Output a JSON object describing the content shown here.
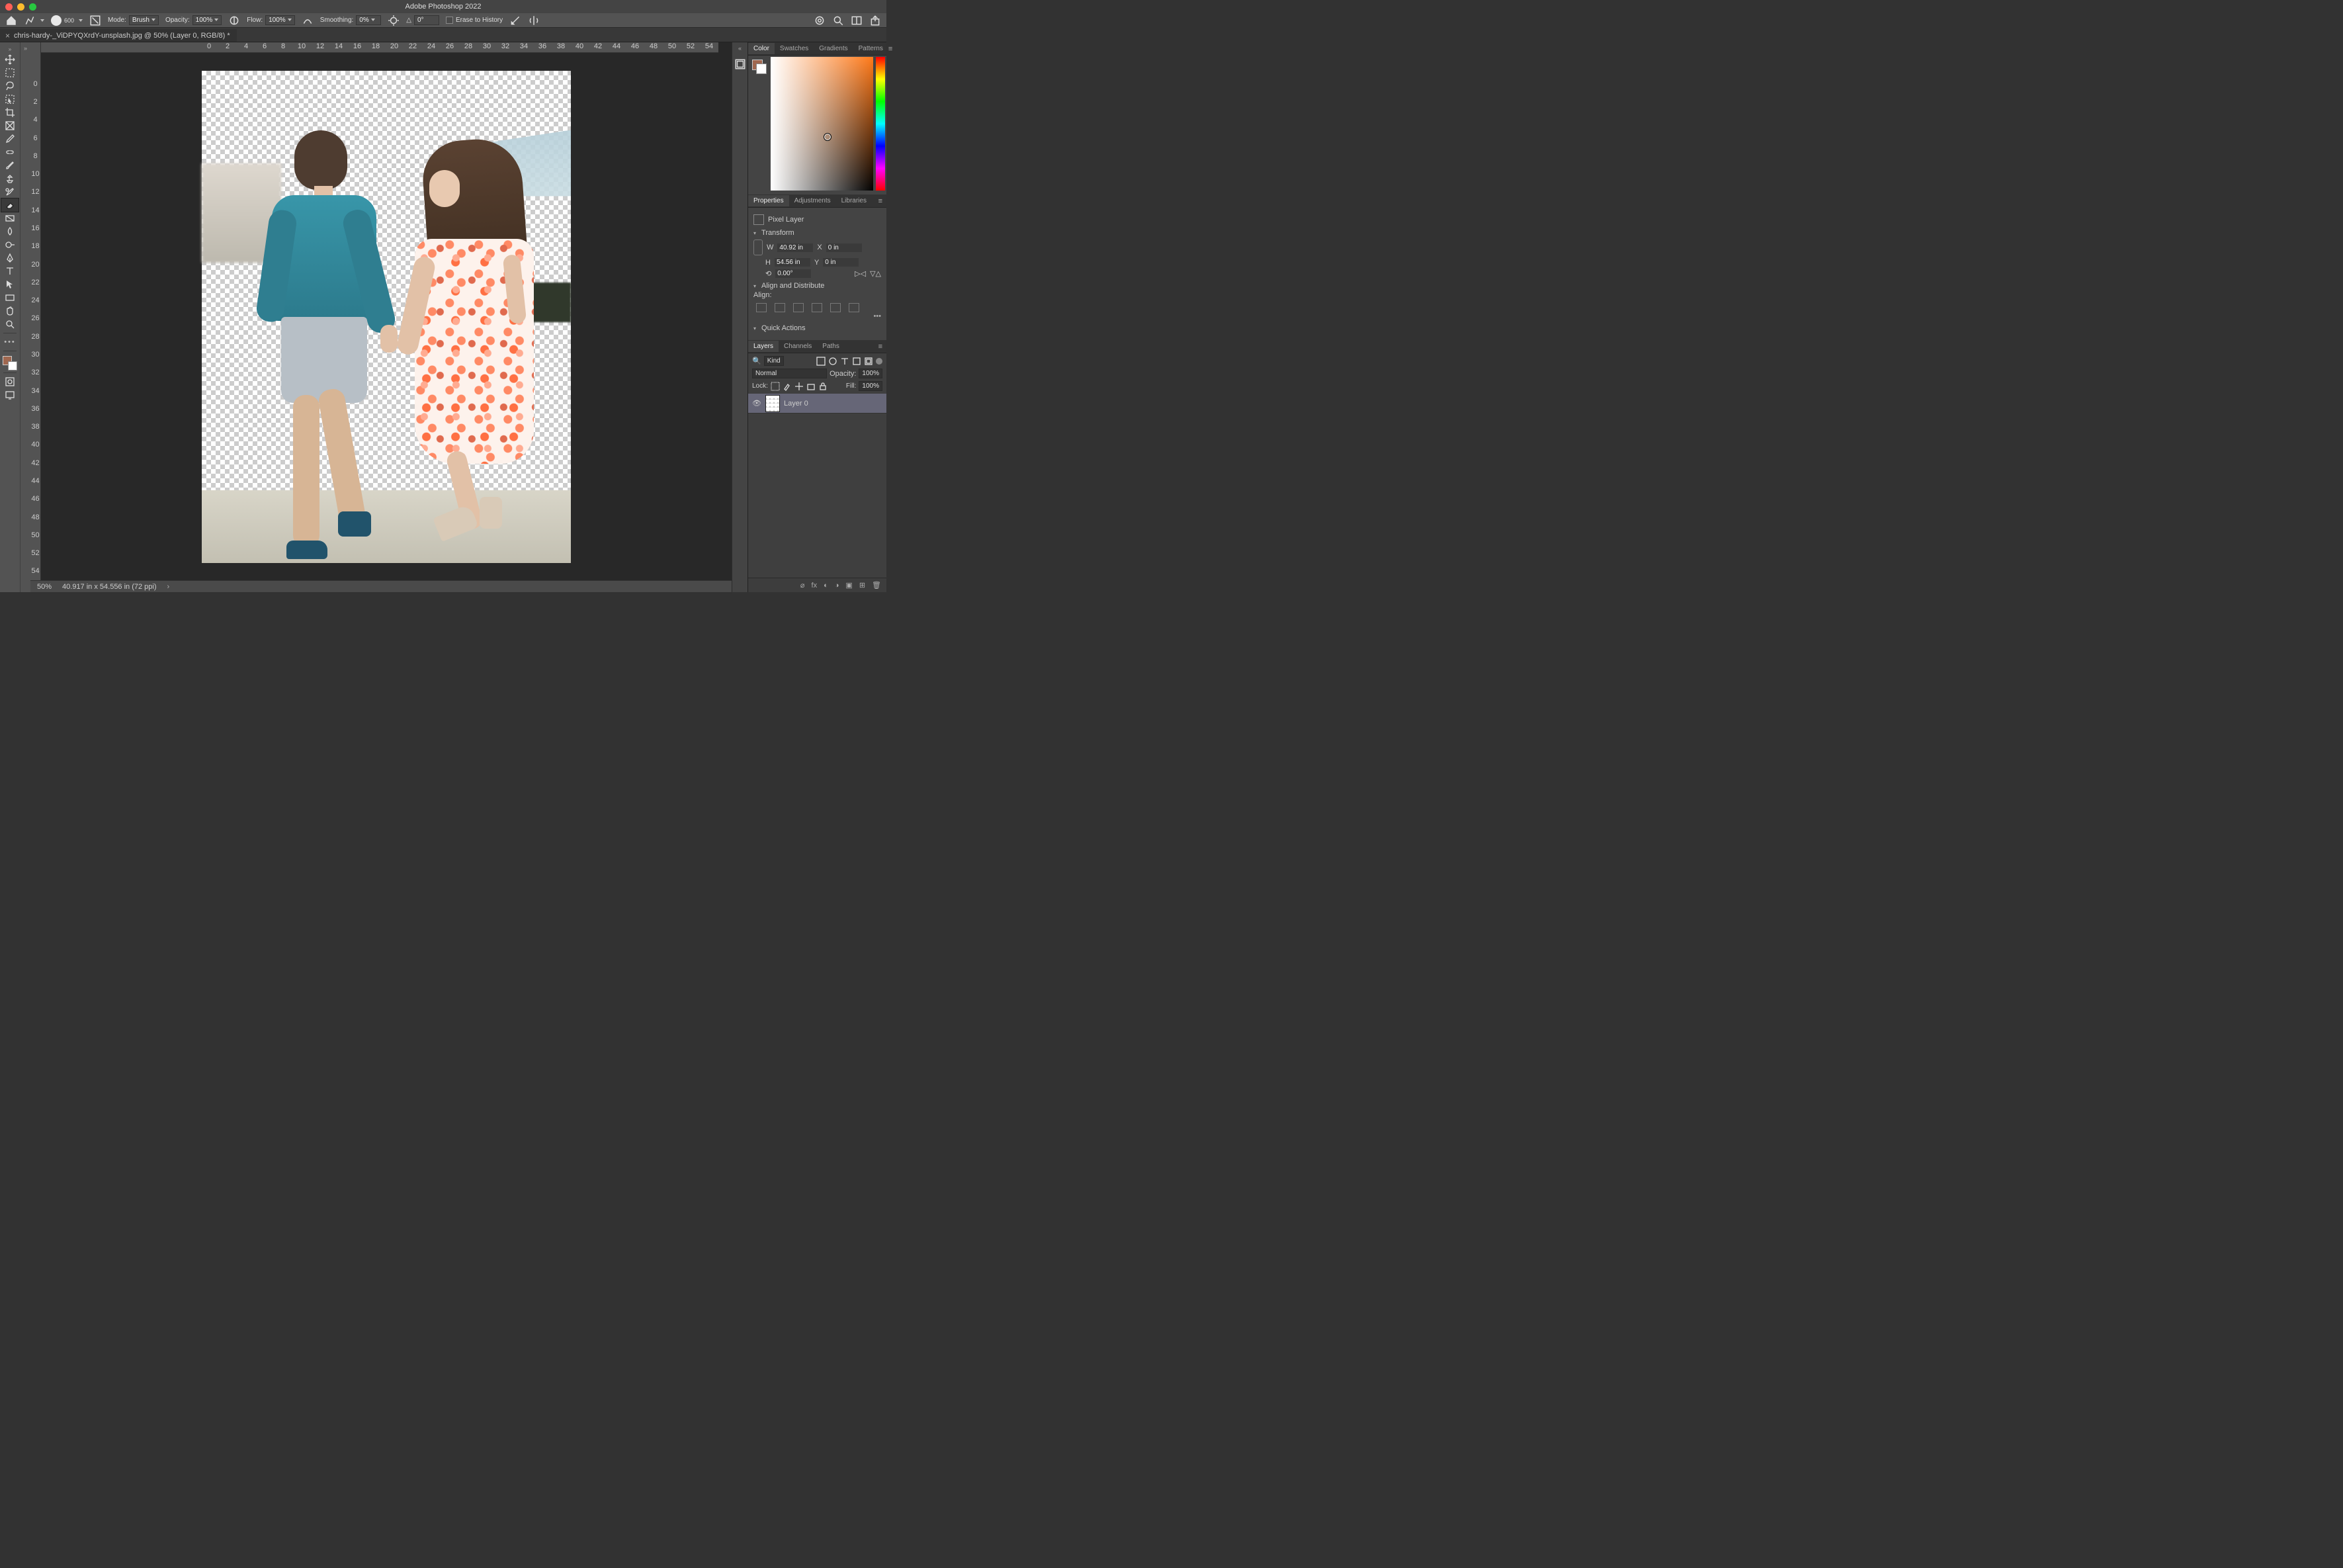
{
  "app_title": "Adobe Photoshop 2022",
  "document_tab": "chris-hardy-_ViDPYQXrdY-unsplash.jpg @ 50% (Layer 0, RGB/8) *",
  "options": {
    "brush_size": "600",
    "mode_label": "Mode:",
    "mode_value": "Brush",
    "opacity_label": "Opacity:",
    "opacity_value": "100%",
    "flow_label": "Flow:",
    "flow_value": "100%",
    "smoothing_label": "Smoothing:",
    "smoothing_value": "0%",
    "angle_label": "△",
    "angle_value": "0°",
    "erase_history_label": "Erase to History"
  },
  "ruler_h": [
    "0",
    "2",
    "4",
    "6",
    "8",
    "10",
    "12",
    "14",
    "16",
    "18",
    "20",
    "22",
    "24",
    "26",
    "28",
    "30",
    "32",
    "34",
    "36",
    "38",
    "40",
    "42",
    "44",
    "46",
    "48",
    "50",
    "52",
    "54"
  ],
  "ruler_v": [
    "0",
    "2",
    "4",
    "6",
    "8",
    "10",
    "12",
    "14",
    "16",
    "18",
    "20",
    "22",
    "24",
    "26",
    "28",
    "30",
    "32",
    "34",
    "36",
    "38",
    "40",
    "42",
    "44",
    "46",
    "48",
    "50",
    "52",
    "54"
  ],
  "panels": {
    "color_tabs": [
      "Color",
      "Swatches",
      "Gradients",
      "Patterns"
    ],
    "prop_tabs": [
      "Properties",
      "Adjustments",
      "Libraries"
    ],
    "layer_tabs": [
      "Layers",
      "Channels",
      "Paths"
    ]
  },
  "properties": {
    "kind": "Pixel Layer",
    "transform_label": "Transform",
    "W": "40.92 in",
    "H": "54.56 in",
    "X": "0 in",
    "Y": "0 in",
    "rotation": "0.00°",
    "align_label": "Align and Distribute",
    "align_sub": "Align:",
    "quick_actions_label": "Quick Actions"
  },
  "layers": {
    "filter_label": "Kind",
    "blend_mode": "Normal",
    "opacity_label": "Opacity:",
    "opacity_value": "100%",
    "lock_label": "Lock:",
    "fill_label": "Fill:",
    "fill_value": "100%",
    "items": [
      {
        "name": "Layer 0",
        "visible": true
      }
    ]
  },
  "status": {
    "zoom": "50%",
    "doc_info": "40.917 in x 54.556 in (72 ppi)"
  }
}
